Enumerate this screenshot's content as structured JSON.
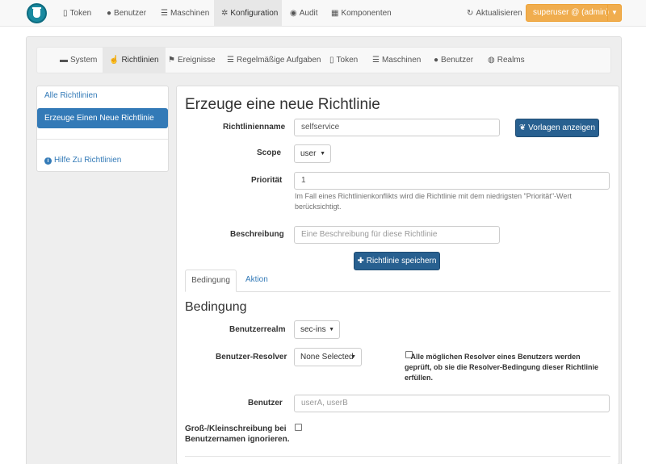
{
  "topnav": {
    "items": [
      {
        "label": "Token",
        "icon": "mobile-icon"
      },
      {
        "label": "Benutzer",
        "icon": "user-icon"
      },
      {
        "label": "Maschinen",
        "icon": "list-icon"
      },
      {
        "label": "Konfiguration",
        "icon": "gear-icon",
        "active": true
      },
      {
        "label": "Audit",
        "icon": "eye-icon"
      },
      {
        "label": "Komponenten",
        "icon": "calendar-icon"
      }
    ],
    "refresh_label": "Aktualisieren",
    "user_label": "superuser @ (admin)"
  },
  "subnav": {
    "items": [
      {
        "label": "System",
        "icon": "briefcase-icon"
      },
      {
        "label": "Richtlinien",
        "icon": "hand-icon",
        "active": true
      },
      {
        "label": "Ereignisse",
        "icon": "flag-icon"
      },
      {
        "label": "Regelmäßige Aufgaben",
        "icon": "list-icon"
      },
      {
        "label": "Token",
        "icon": "mobile-icon"
      },
      {
        "label": "Maschinen",
        "icon": "list-icon"
      },
      {
        "label": "Benutzer",
        "icon": "user-icon"
      },
      {
        "label": "Realms",
        "icon": "globe-icon"
      }
    ]
  },
  "sidebar": {
    "all_policies": "Alle Richtlinien",
    "create_policy": "Erzeuge Einen Neue Richtlinie",
    "help": "Hilfe Zu Richtlinien"
  },
  "form": {
    "title": "Erzeuge eine neue Richtlinie",
    "name_label": "Richtlinienname",
    "name_value": "selfservice",
    "templates_button": "Vorlagen anzeigen",
    "scope_label": "Scope",
    "scope_value": "user",
    "priority_label": "Priorität",
    "priority_value": "1",
    "priority_help": "Im Fall eines Richtlinienkonflikts wird die Richtlinie mit dem niedrigsten \"Priorität\"-Wert berücksichtigt.",
    "description_label": "Beschreibung",
    "description_placeholder": "Eine Beschreibung für diese Richtlinie",
    "save_button": "Richtlinie speichern"
  },
  "tabs": {
    "condition": "Bedingung",
    "action": "Aktion"
  },
  "condition": {
    "heading": "Bedingung",
    "realm_label": "Benutzerrealm",
    "realm_value": "sec-ins",
    "resolver_label": "Benutzer-Resolver",
    "resolver_value": "None Selected",
    "resolver_check_label": "Alle möglichen Resolver eines Benutzers werden geprüft, ob sie die Resolver-Bedingung dieser Richtlinie erfüllen.",
    "user_label": "Benutzer",
    "user_placeholder": "userA, userB",
    "case_label_line1": "Groß-/Kleinschreibung bei",
    "case_label_line2": "Benutzernamen ignorieren."
  },
  "colors": {
    "primary": "#337ab7",
    "primary_dark": "#286090",
    "warning": "#f0ad4e",
    "logo": "#1a8aa0"
  }
}
